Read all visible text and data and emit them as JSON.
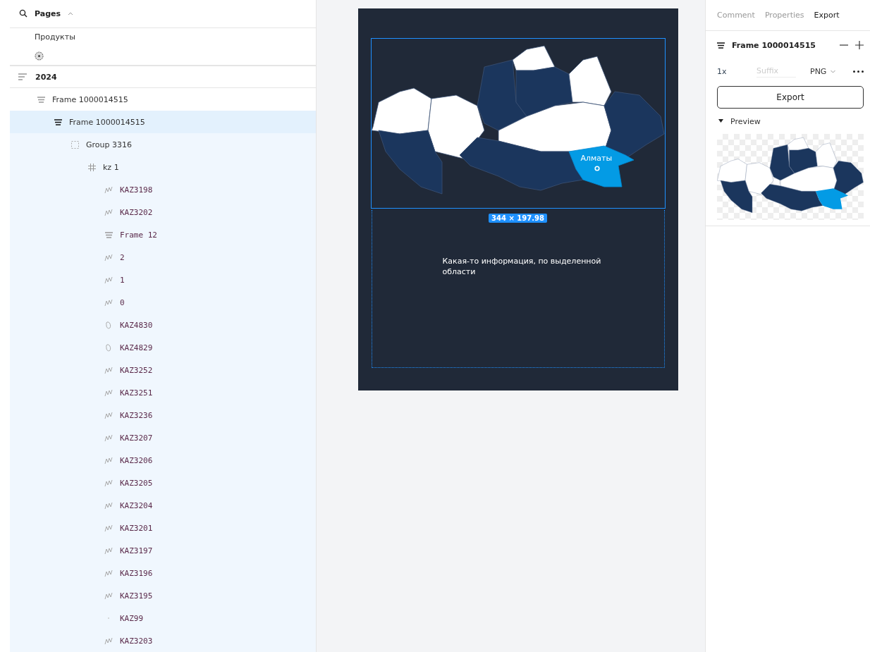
{
  "pages": {
    "title": "Pages",
    "expanded": true,
    "items": [
      {
        "kind": "text",
        "label": "Продукты"
      },
      {
        "kind": "emoji-icon"
      }
    ]
  },
  "section": {
    "label": "2024"
  },
  "layers": [
    {
      "name": "Frame 1000014515",
      "kind": "frame",
      "selected": false,
      "children": [
        {
          "name": "Frame 1000014515",
          "kind": "frame",
          "selected": true,
          "children": [
            {
              "name": "Group 3316",
              "kind": "group",
              "selected": false,
              "children": [
                {
                  "name": "kz 1",
                  "kind": "grid",
                  "selected": false,
                  "children": [
                    {
                      "name": "KAZ3198",
                      "kind": "vector",
                      "selected": false
                    },
                    {
                      "name": "KAZ3202",
                      "kind": "vector",
                      "selected": false
                    },
                    {
                      "name": "Frame 12",
                      "kind": "frame",
                      "selected": false
                    },
                    {
                      "name": "2",
                      "kind": "vector",
                      "selected": false
                    },
                    {
                      "name": "1",
                      "kind": "vector",
                      "selected": false
                    },
                    {
                      "name": "0",
                      "kind": "vector",
                      "selected": false
                    },
                    {
                      "name": "KAZ4830",
                      "kind": "shape",
                      "selected": false
                    },
                    {
                      "name": "KAZ4829",
                      "kind": "shape",
                      "selected": false
                    },
                    {
                      "name": "KAZ3252",
                      "kind": "vector",
                      "selected": false
                    },
                    {
                      "name": "KAZ3251",
                      "kind": "vector",
                      "selected": false
                    },
                    {
                      "name": "KAZ3236",
                      "kind": "vector",
                      "selected": false
                    },
                    {
                      "name": "KAZ3207",
                      "kind": "vector",
                      "selected": false
                    },
                    {
                      "name": "KAZ3206",
                      "kind": "vector",
                      "selected": false
                    },
                    {
                      "name": "KAZ3205",
                      "kind": "vector",
                      "selected": false
                    },
                    {
                      "name": "KAZ3204",
                      "kind": "vector",
                      "selected": false
                    },
                    {
                      "name": "KAZ3201",
                      "kind": "vector",
                      "selected": false
                    },
                    {
                      "name": "KAZ3197",
                      "kind": "vector",
                      "selected": false
                    },
                    {
                      "name": "KAZ3196",
                      "kind": "vector",
                      "selected": false
                    },
                    {
                      "name": "KAZ3195",
                      "kind": "vector",
                      "selected": false
                    },
                    {
                      "name": "KAZ99",
                      "kind": "dot",
                      "selected": false
                    },
                    {
                      "name": "KAZ3203",
                      "kind": "vector",
                      "selected": false
                    }
                  ]
                }
              ]
            }
          ]
        }
      ]
    }
  ],
  "canvas": {
    "highlighted_region": "Алматы",
    "size_badge": "344 × 197.98",
    "info_text": "Какая-то информация, по выделенной области"
  },
  "right_panel": {
    "tabs": [
      {
        "label": "Comment",
        "selected": false
      },
      {
        "label": "Properties",
        "selected": false
      },
      {
        "label": "Export",
        "selected": true
      }
    ],
    "layer_name": "Frame 1000014515",
    "scale": "1x",
    "suffix_placeholder": "Suffix",
    "format": "PNG",
    "export_button": "Export",
    "preview": {
      "label": "Preview",
      "expanded": true
    }
  }
}
